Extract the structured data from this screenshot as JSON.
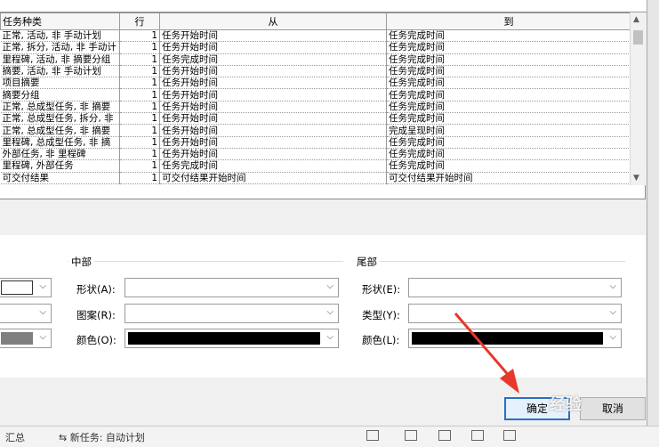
{
  "table": {
    "headers": [
      "任务种类",
      "行",
      "从",
      "到"
    ],
    "rows": [
      [
        "正常, 活动, 非 手动计划",
        "1",
        "任务开始时间",
        "任务完成时间"
      ],
      [
        "正常, 拆分, 活动, 非 手动计",
        "1",
        "任务开始时间",
        "任务完成时间"
      ],
      [
        "里程碑, 活动, 非 摘要分组",
        "1",
        "任务完成时间",
        "任务完成时间"
      ],
      [
        "摘要, 活动, 非 手动计划",
        "1",
        "任务开始时间",
        "任务完成时间"
      ],
      [
        "项目摘要",
        "1",
        "任务开始时间",
        "任务完成时间"
      ],
      [
        "摘要分组",
        "1",
        "任务开始时间",
        "任务完成时间"
      ],
      [
        "正常, 总成型任务, 非 摘要",
        "1",
        "任务开始时间",
        "任务完成时间"
      ],
      [
        "正常, 总成型任务, 拆分, 非",
        "1",
        "任务开始时间",
        "任务完成时间"
      ],
      [
        "正常, 总成型任务, 非 摘要",
        "1",
        "任务开始时间",
        "完成呈现时间"
      ],
      [
        "里程碑, 总成型任务, 非 摘",
        "1",
        "任务开始时间",
        "任务完成时间"
      ],
      [
        "外部任务, 非 里程碑",
        "1",
        "任务开始时间",
        "任务完成时间"
      ],
      [
        "里程碑, 外部任务",
        "1",
        "任务完成时间",
        "任务完成时间"
      ],
      [
        "可交付结果",
        "1",
        "可交付结果开始时间",
        "可交付结果开始时间"
      ]
    ]
  },
  "middle_group": {
    "title": "中部",
    "shape_label": "形状(A):",
    "pattern_label": "图案(R):",
    "color_label": "颜色(O):"
  },
  "end_group": {
    "title": "尾部",
    "shape_label": "形状(E):",
    "type_label": "类型(Y):",
    "color_label": "颜色(L):"
  },
  "colors": {
    "middle_color": "#000000",
    "end_color": "#000000",
    "left_color": "#7f7f7f",
    "ok_border": "#2a6fc9",
    "arrow": "#e8382c"
  },
  "buttons": {
    "ok_label": "确定",
    "cancel_label": "取消"
  },
  "status_bar": {
    "left_text": "汇总",
    "task_mode_text": "新任务: 自动计划"
  },
  "icons": [
    "chevron-down-icon",
    "scroll-up-icon",
    "scroll-down-icon",
    "view-icon",
    "red-arrow-icon"
  ]
}
